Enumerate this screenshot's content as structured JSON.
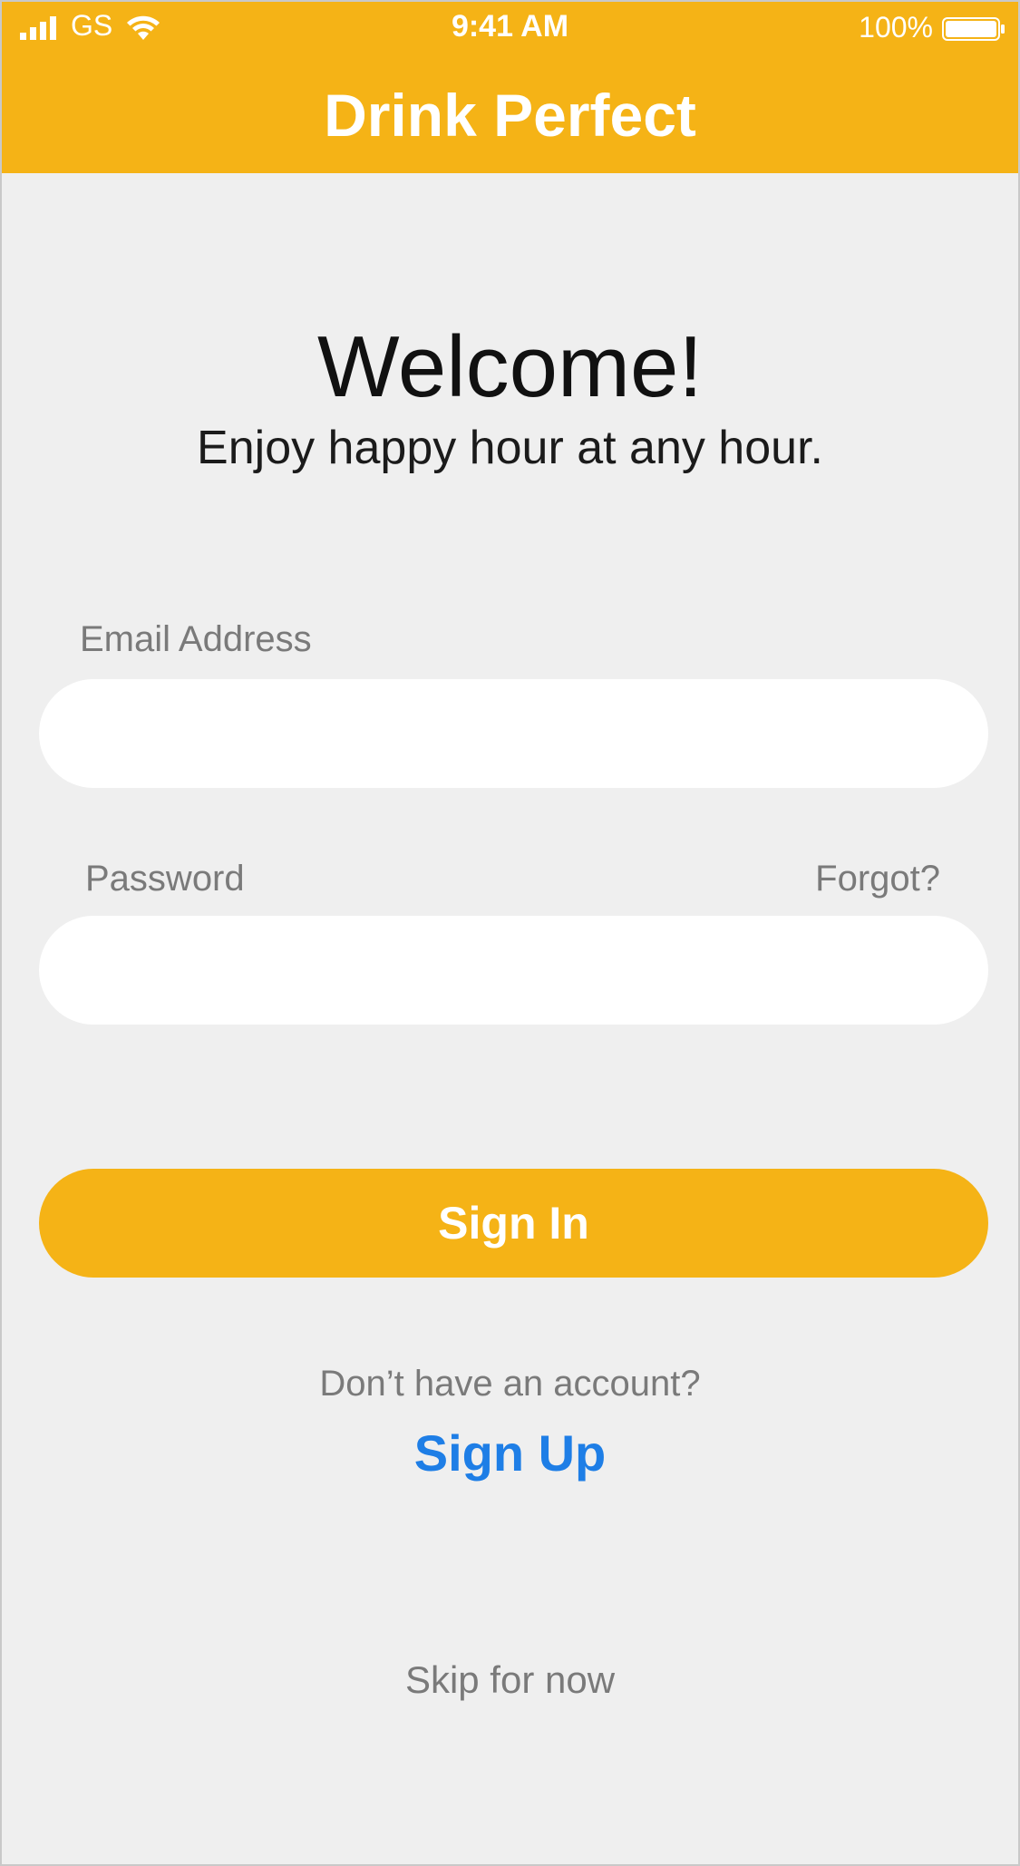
{
  "status_bar": {
    "carrier": "GS",
    "time": "9:41 AM",
    "battery": "100%"
  },
  "header": {
    "title": "Drink Perfect"
  },
  "hero": {
    "heading": "Welcome!",
    "tagline": "Enjoy happy hour at any hour."
  },
  "form": {
    "email_label": "Email Address",
    "email_value": "",
    "password_label": "Password",
    "password_value": "",
    "forgot_link": "Forgot?",
    "signin_label": "Sign In"
  },
  "footer": {
    "prompt": "Don’t have an account?",
    "signup_link": "Sign Up",
    "skip_link": "Skip for now"
  },
  "colors": {
    "brand": "#f5b316",
    "link": "#1e7ee6",
    "background": "#efefef"
  },
  "icons": [
    "signal-icon",
    "wifi-icon",
    "battery-icon"
  ]
}
